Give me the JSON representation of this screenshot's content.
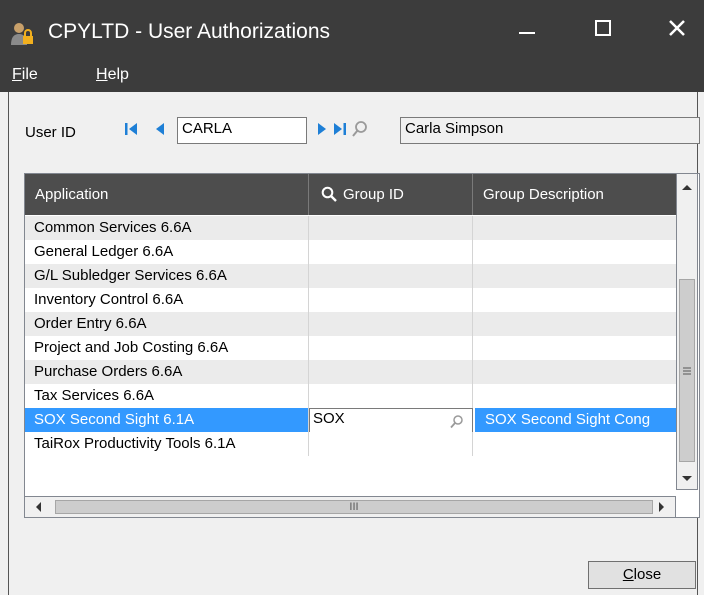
{
  "window": {
    "title": "CPYLTD - User Authorizations"
  },
  "menu": {
    "items": [
      {
        "mnemonic": "F",
        "rest": "ile"
      },
      {
        "mnemonic": "H",
        "rest": "elp"
      }
    ]
  },
  "user": {
    "label": "User ID",
    "value": "CARLA",
    "name": "Carla Simpson"
  },
  "grid": {
    "columns": [
      "Application",
      "Group ID",
      "Group Description"
    ],
    "rows": [
      {
        "application": "Common Services 6.6A",
        "group_id": "",
        "group_description": ""
      },
      {
        "application": "General Ledger 6.6A",
        "group_id": "",
        "group_description": ""
      },
      {
        "application": "G/L Subledger Services 6.6A",
        "group_id": "",
        "group_description": ""
      },
      {
        "application": "Inventory Control 6.6A",
        "group_id": "",
        "group_description": ""
      },
      {
        "application": "Order Entry 6.6A",
        "group_id": "",
        "group_description": ""
      },
      {
        "application": "Project and Job Costing 6.6A",
        "group_id": "",
        "group_description": ""
      },
      {
        "application": "Purchase Orders 6.6A",
        "group_id": "",
        "group_description": ""
      },
      {
        "application": "Tax Services 6.6A",
        "group_id": "",
        "group_description": ""
      },
      {
        "application": "SOX Second Sight 6.1A",
        "group_id": "SOX",
        "group_description": "SOX Second Sight Cong"
      },
      {
        "application": "TaiRox Productivity Tools 6.1A",
        "group_id": "",
        "group_description": ""
      }
    ],
    "scroll_marker": "III"
  },
  "buttons": {
    "close_mnemonic": "C",
    "close_rest": "lose"
  },
  "colors": {
    "titlebar": "#3c3c3c",
    "selection": "#3399ff",
    "nav_arrows": "#1e7fd6"
  }
}
